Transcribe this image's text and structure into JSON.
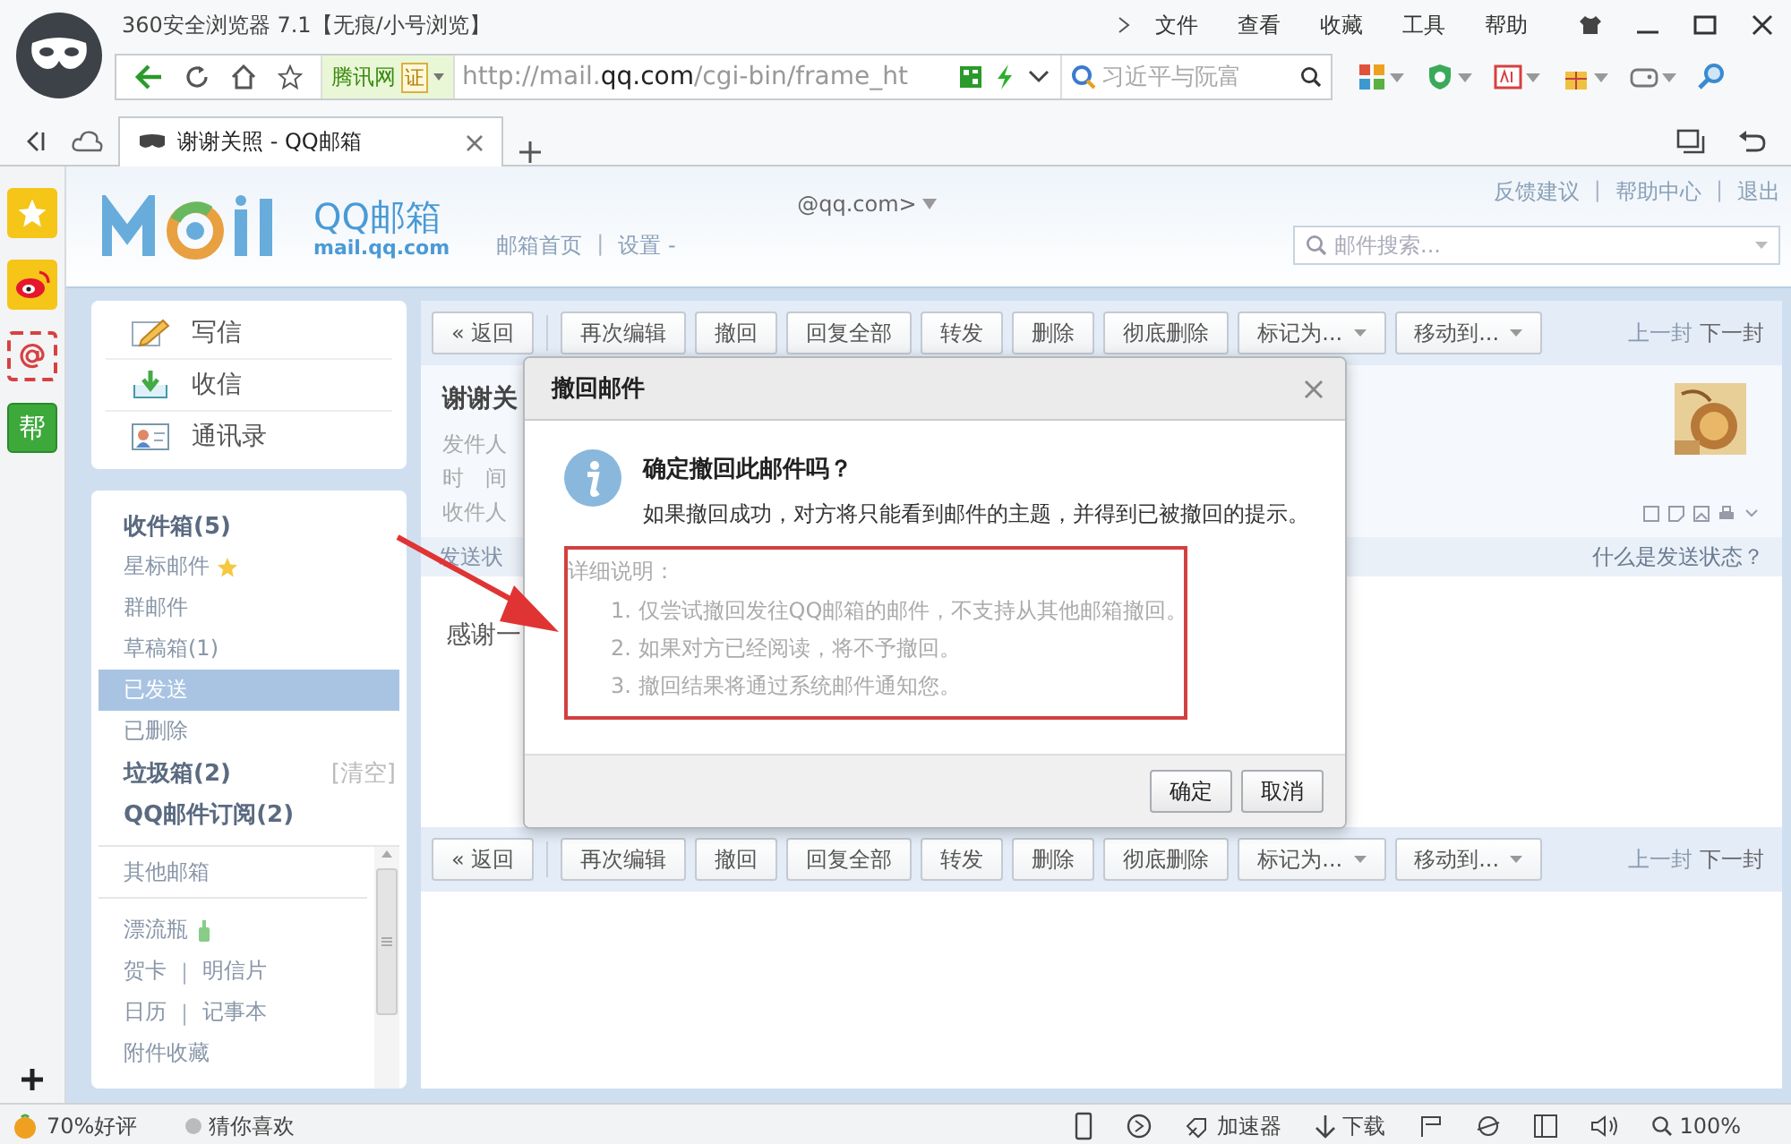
{
  "browser": {
    "title": "360安全浏览器 7.1【无痕/小号浏览】",
    "menu": [
      "文件",
      "查看",
      "收藏",
      "工具",
      "帮助"
    ],
    "site_label": "腾讯网",
    "cert": "证",
    "url_prefix": "http://mail.",
    "url_domain": "qq.com",
    "url_path": "/cgi-bin/frame_ht",
    "search_text": "习近平与阮富",
    "tabs": [
      {
        "title": "谢谢关照 - QQ邮箱",
        "selected": true
      }
    ]
  },
  "app_sidebar": {
    "help_label": "帮"
  },
  "mail": {
    "brand": "QQ邮箱",
    "domain": "mail.qq.com",
    "account": "@qq.com>",
    "nav_links": [
      "邮箱首页",
      "|",
      "设置 -"
    ],
    "top_links": [
      "反馈建议",
      "|",
      "帮助中心",
      "|",
      "退出"
    ],
    "search_placeholder": "邮件搜索..."
  },
  "quick_actions": [
    {
      "kind": "compose",
      "label": "写信"
    },
    {
      "kind": "receive",
      "label": "收信"
    },
    {
      "kind": "contacts",
      "label": "通讯录"
    }
  ],
  "folders": [
    {
      "label": "收件箱(5)",
      "unread": true,
      "selected": false
    },
    {
      "label": "星标邮件",
      "unread": false,
      "selected": false,
      "kind": "starred"
    },
    {
      "label": "群邮件",
      "unread": false,
      "selected": false
    },
    {
      "label": "草稿箱(1)",
      "unread": false,
      "selected": false
    },
    {
      "label": "已发送",
      "unread": false,
      "selected": true
    },
    {
      "label": "已删除",
      "unread": false,
      "selected": false
    },
    {
      "label": "垃圾箱(2)",
      "unread": true,
      "selected": false,
      "action": "[清空]"
    },
    {
      "label": "QQ邮件订阅(2)",
      "unread": true,
      "selected": false
    }
  ],
  "other_mailboxes": "其他邮箱",
  "tools": [
    {
      "links": [
        "漂流瓶"
      ],
      "kind": "bottle"
    },
    {
      "links": [
        "贺卡",
        "|",
        "明信片"
      ]
    },
    {
      "links": [
        "日历",
        "|",
        "记事本"
      ]
    },
    {
      "links": [
        "附件收藏"
      ]
    }
  ],
  "toolbar_top": {
    "buttons": [
      {
        "label": "« 返回",
        "dropdown": false
      },
      {
        "label": "再次编辑",
        "dropdown": false
      },
      {
        "label": "撤回",
        "dropdown": false
      },
      {
        "label": "回复全部",
        "dropdown": false
      },
      {
        "label": "转发",
        "dropdown": false
      },
      {
        "label": "删除",
        "dropdown": false
      },
      {
        "label": "彻底删除",
        "dropdown": false
      },
      {
        "label": "标记为...",
        "dropdown": true
      },
      {
        "label": "移动到...",
        "dropdown": true
      }
    ],
    "pager": [
      {
        "label": "上一封",
        "disabled": true
      },
      {
        "label": "下一封",
        "disabled": false
      }
    ]
  },
  "message": {
    "subject": "谢谢关",
    "fields": [
      "发件人",
      "时　间",
      "收件人"
    ],
    "status_label": "发送状",
    "status_help": "什么是发送状态？",
    "body": "感谢一"
  },
  "toolbar_bottom": {
    "buttons": [
      {
        "label": "« 返回",
        "dropdown": false
      },
      {
        "label": "再次编辑",
        "dropdown": false
      },
      {
        "label": "撤回",
        "dropdown": false
      },
      {
        "label": "回复全部",
        "dropdown": false
      },
      {
        "label": "转发",
        "dropdown": false
      },
      {
        "label": "删除",
        "dropdown": false
      },
      {
        "label": "彻底删除",
        "dropdown": false
      },
      {
        "label": "标记为...",
        "dropdown": true
      },
      {
        "label": "移动到...",
        "dropdown": true
      }
    ],
    "pager": [
      {
        "label": "上一封",
        "disabled": true
      },
      {
        "label": "下一封",
        "disabled": false
      }
    ]
  },
  "dialog": {
    "title": "撤回邮件",
    "heading": "确定撤回此邮件吗？",
    "message": "如果撤回成功，对方将只能看到邮件的主题，并得到已被撤回的提示。",
    "details_label": "详细说明：",
    "details": [
      "1. 仅尝试撤回发往QQ邮箱的邮件，不支持从其他邮箱撤回。",
      "2. 如果对方已经阅读，将不予撤回。",
      "3. 撤回结果将通过系统邮件通知您。"
    ],
    "buttons": [
      "确定",
      "取消"
    ]
  },
  "status_bar": {
    "rating": "70%好评",
    "recommend": "猜你喜欢",
    "accelerator": "加速器",
    "download": "下载",
    "zoom": "100%"
  }
}
